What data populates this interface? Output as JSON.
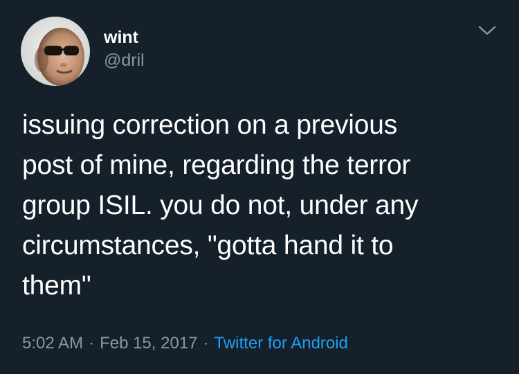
{
  "tweet": {
    "display_name": "wint",
    "handle": "@dril",
    "text": "issuing correction on a previous\npost of mine, regarding the terror\ngroup ISIL. you do not, under any\ncircumstances, \"gotta hand it to\nthem\"",
    "time": "5:02 AM",
    "date": "Feb 15, 2017",
    "source": "Twitter for Android",
    "separator": "·"
  },
  "icons": {
    "menu": "chevron-down-icon",
    "avatar": "avatar"
  },
  "colors": {
    "background": "#15202b",
    "text": "#ffffff",
    "secondary": "#8899a6",
    "link": "#1da1f2"
  }
}
